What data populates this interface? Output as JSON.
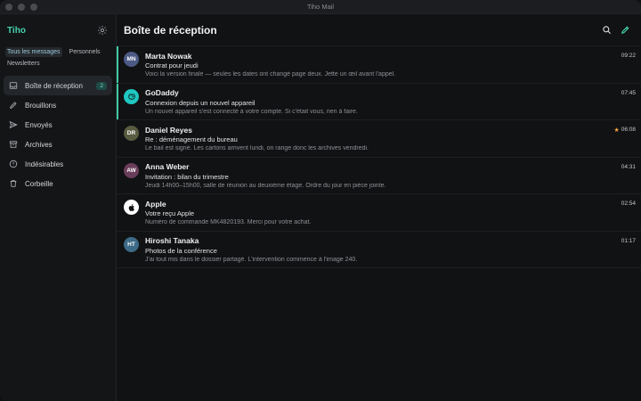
{
  "window": {
    "title": "Tiho Mail"
  },
  "sidebar": {
    "account": "Tiho",
    "filters": [
      "Tous les messages",
      "Personnels",
      "Newsletters"
    ],
    "items": [
      {
        "label": "Boîte de réception",
        "icon": "inbox-icon",
        "badge": "2"
      },
      {
        "label": "Brouillons",
        "icon": "pencil-icon"
      },
      {
        "label": "Envoyés",
        "icon": "send-icon"
      },
      {
        "label": "Archives",
        "icon": "archive-icon"
      },
      {
        "label": "Indésirables",
        "icon": "alert-circle-icon"
      },
      {
        "label": "Corbeille",
        "icon": "trash-icon"
      }
    ]
  },
  "main": {
    "title": "Boîte de réception"
  },
  "colors": {
    "accent": "#44d3ad"
  },
  "messages": [
    {
      "initials": "MN",
      "avatar_color": "#4c5a86",
      "sender": "Marta Nowak",
      "time": "09:22",
      "subject": "Contrat pour jeudi",
      "preview": "Voici la version finale — seules les dates ont changé page deux. Jette un œil avant l'appel."
    },
    {
      "initials": "",
      "avatar_color": "#1fc7c1",
      "sender": "GoDaddy",
      "time": "07:45",
      "subject": "Connexion depuis un nouvel appareil",
      "preview": "Un nouvel appareil s'est connecté à votre compte. Si c'était vous, rien à faire."
    },
    {
      "initials": "DR",
      "avatar_color": "#5a5c41",
      "sender": "Daniel Reyes",
      "time": "06:08",
      "subject": "Re : déménagement du bureau",
      "preview": "Le bail est signé. Les cartons arrivent lundi, on range donc les archives vendredi."
    },
    {
      "initials": "AW",
      "avatar_color": "#6a3d5a",
      "sender": "Anna Weber",
      "time": "04:31",
      "subject": "Invitation : bilan du trimestre",
      "preview": "Jeudi 14h00–15h00, salle de réunion au deuxième étage. Ordre du jour en pièce jointe."
    },
    {
      "initials": "",
      "avatar_color": "#ffffff",
      "sender": "Apple",
      "time": "02:54",
      "subject": "Votre reçu Apple",
      "preview": "Numéro de commande MK4820193. Merci pour votre achat."
    },
    {
      "initials": "HT",
      "avatar_color": "#3d6a86",
      "sender": "Hiroshi Tanaka",
      "time": "01:17",
      "subject": "Photos de la conférence",
      "preview": "J'ai tout mis dans le dossier partagé. L'intervention commence à l'image 240."
    }
  ]
}
